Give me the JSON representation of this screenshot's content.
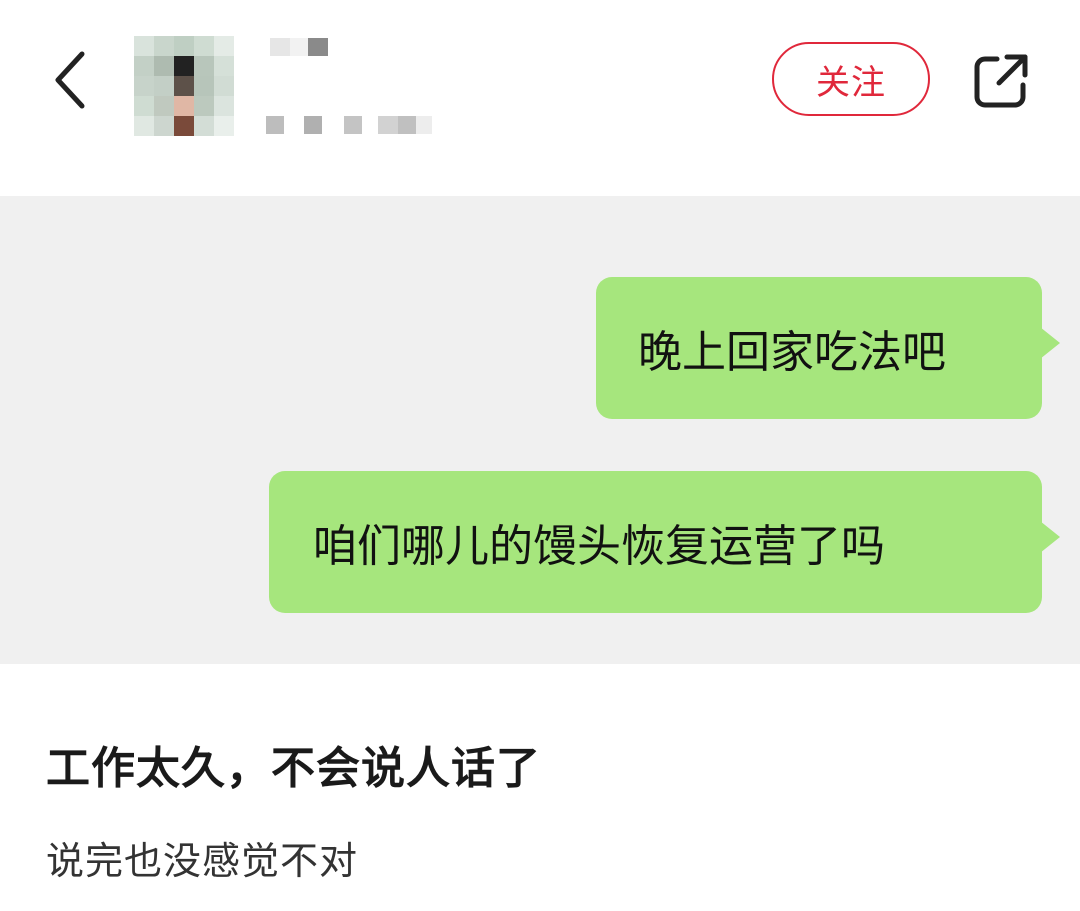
{
  "header": {
    "back_icon": "chevron-left-icon",
    "follow_label": "关注",
    "share_icon": "share-external-icon",
    "accent_color": "#e0283b"
  },
  "chat": {
    "bubble_color": "#a6e67d",
    "messages": [
      {
        "text": "晚上回家吃法吧",
        "side": "right"
      },
      {
        "text": "咱们哪儿的馒头恢复运营了吗",
        "side": "right"
      }
    ]
  },
  "post": {
    "title": "工作太久，不会说人话了",
    "subtitle": "说完也没感觉不对"
  }
}
